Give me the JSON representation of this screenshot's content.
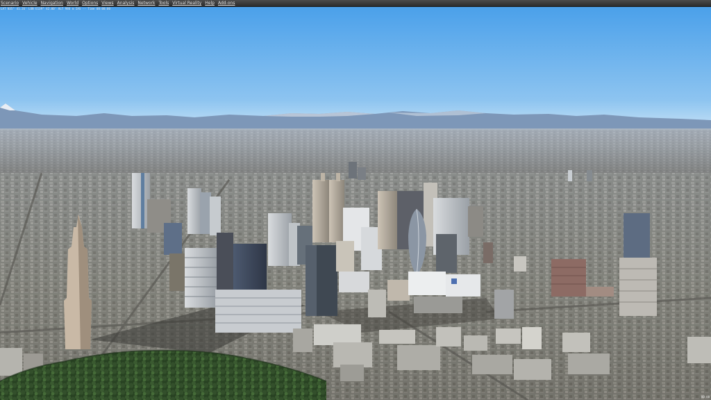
{
  "menubar": {
    "items": [
      "Scenario",
      "Vehicle",
      "Navigation",
      "World",
      "Options",
      "Views",
      "Analysis",
      "Network",
      "Tools",
      "Virtual Reality",
      "Help",
      "Add-ons"
    ]
  },
  "readout": {
    "text": "LAT N35° 41.26'  LON E139° 42.00'  ALT 986 m  IAS --  Time 08:00:00"
  },
  "corner": {
    "text": "00:00"
  },
  "colors": {
    "menu_bg": "#3a3a3a",
    "sky_top": "#4aa0ea",
    "sky_horizon": "#cbe6f7",
    "mountains": "#7c95b7",
    "city": "#8a8f93",
    "park": "#2f4a2a"
  }
}
